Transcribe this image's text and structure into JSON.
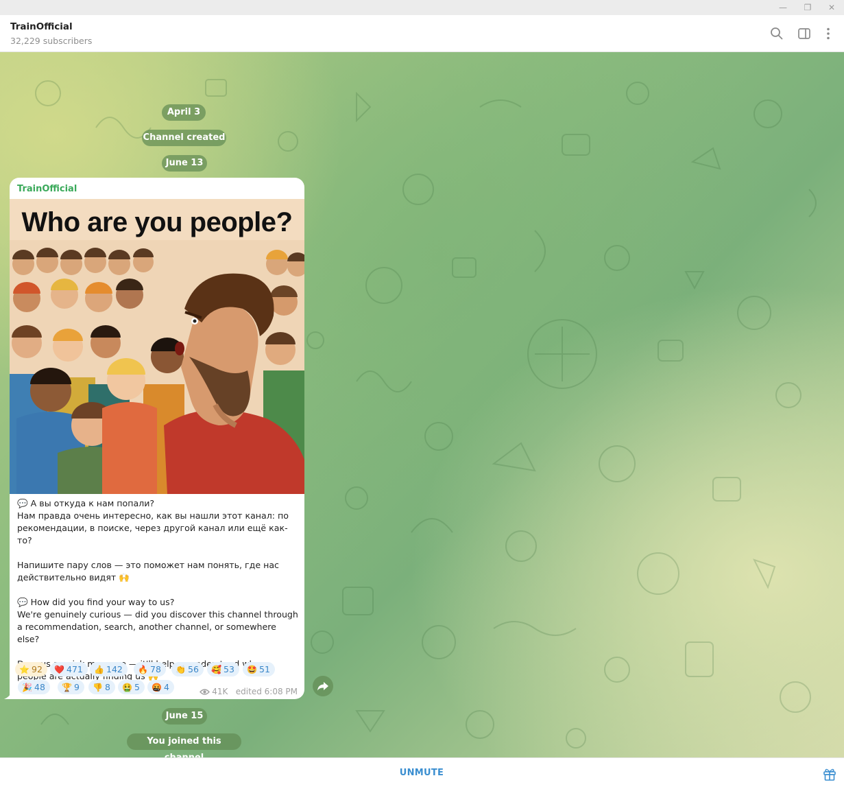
{
  "window": {
    "minimize_glyph": "—",
    "restore_glyph": "❐",
    "close_glyph": "✕"
  },
  "header": {
    "title": "TrainOfficial",
    "subtitle": "32,229 subscribers",
    "icons": [
      "search-icon",
      "sidebar-toggle-icon",
      "more-vertical-icon"
    ]
  },
  "chat": {
    "service_date_1": "April 3",
    "service_created": "Channel created",
    "service_date_2": "June 13",
    "service_date_3": "June 15",
    "service_joined": "You joined this channel"
  },
  "message": {
    "author": "TrainOfficial",
    "image_title": "Who are you people?",
    "text": "💬 А вы откуда к нам попали?\nНам правда очень интересно, как вы нашли этот канал: по рекомендации, в поиске, через другой канал или ещё как-то?\n\nНапишите пару слов — это поможет нам понять, где нас действительно видят 🙌\n\n💬 How did you find your way to us?\nWe're genuinely curious — did you discover this channel through a recommendation, search, another channel, or somewhere else?\n\nDrop us a quick message — it'll help us understand where people are actually finding us 🙌",
    "views": "41K",
    "edited": "edited 6:08 PM",
    "reactions": [
      {
        "emoji": "⭐",
        "count": "92",
        "chosen": true
      },
      {
        "emoji": "❤️",
        "count": "471"
      },
      {
        "emoji": "👍",
        "count": "142"
      },
      {
        "emoji": "🔥",
        "count": "78"
      },
      {
        "emoji": "👏",
        "count": "56"
      },
      {
        "emoji": "🥰",
        "count": "53"
      },
      {
        "emoji": "🤩",
        "count": "51"
      },
      {
        "emoji": "🎉",
        "count": "48"
      },
      {
        "emoji": "🏆",
        "count": "9"
      },
      {
        "emoji": "👎",
        "count": "8"
      },
      {
        "emoji": "🤮",
        "count": "5"
      },
      {
        "emoji": "🤬",
        "count": "4"
      }
    ]
  },
  "footer": {
    "unmute_label": "UNMUTE",
    "gift_icon": "gift-icon"
  },
  "colors": {
    "accent": "#3a8ed0",
    "author": "#3aa95a",
    "service_bg": "#628c54"
  }
}
